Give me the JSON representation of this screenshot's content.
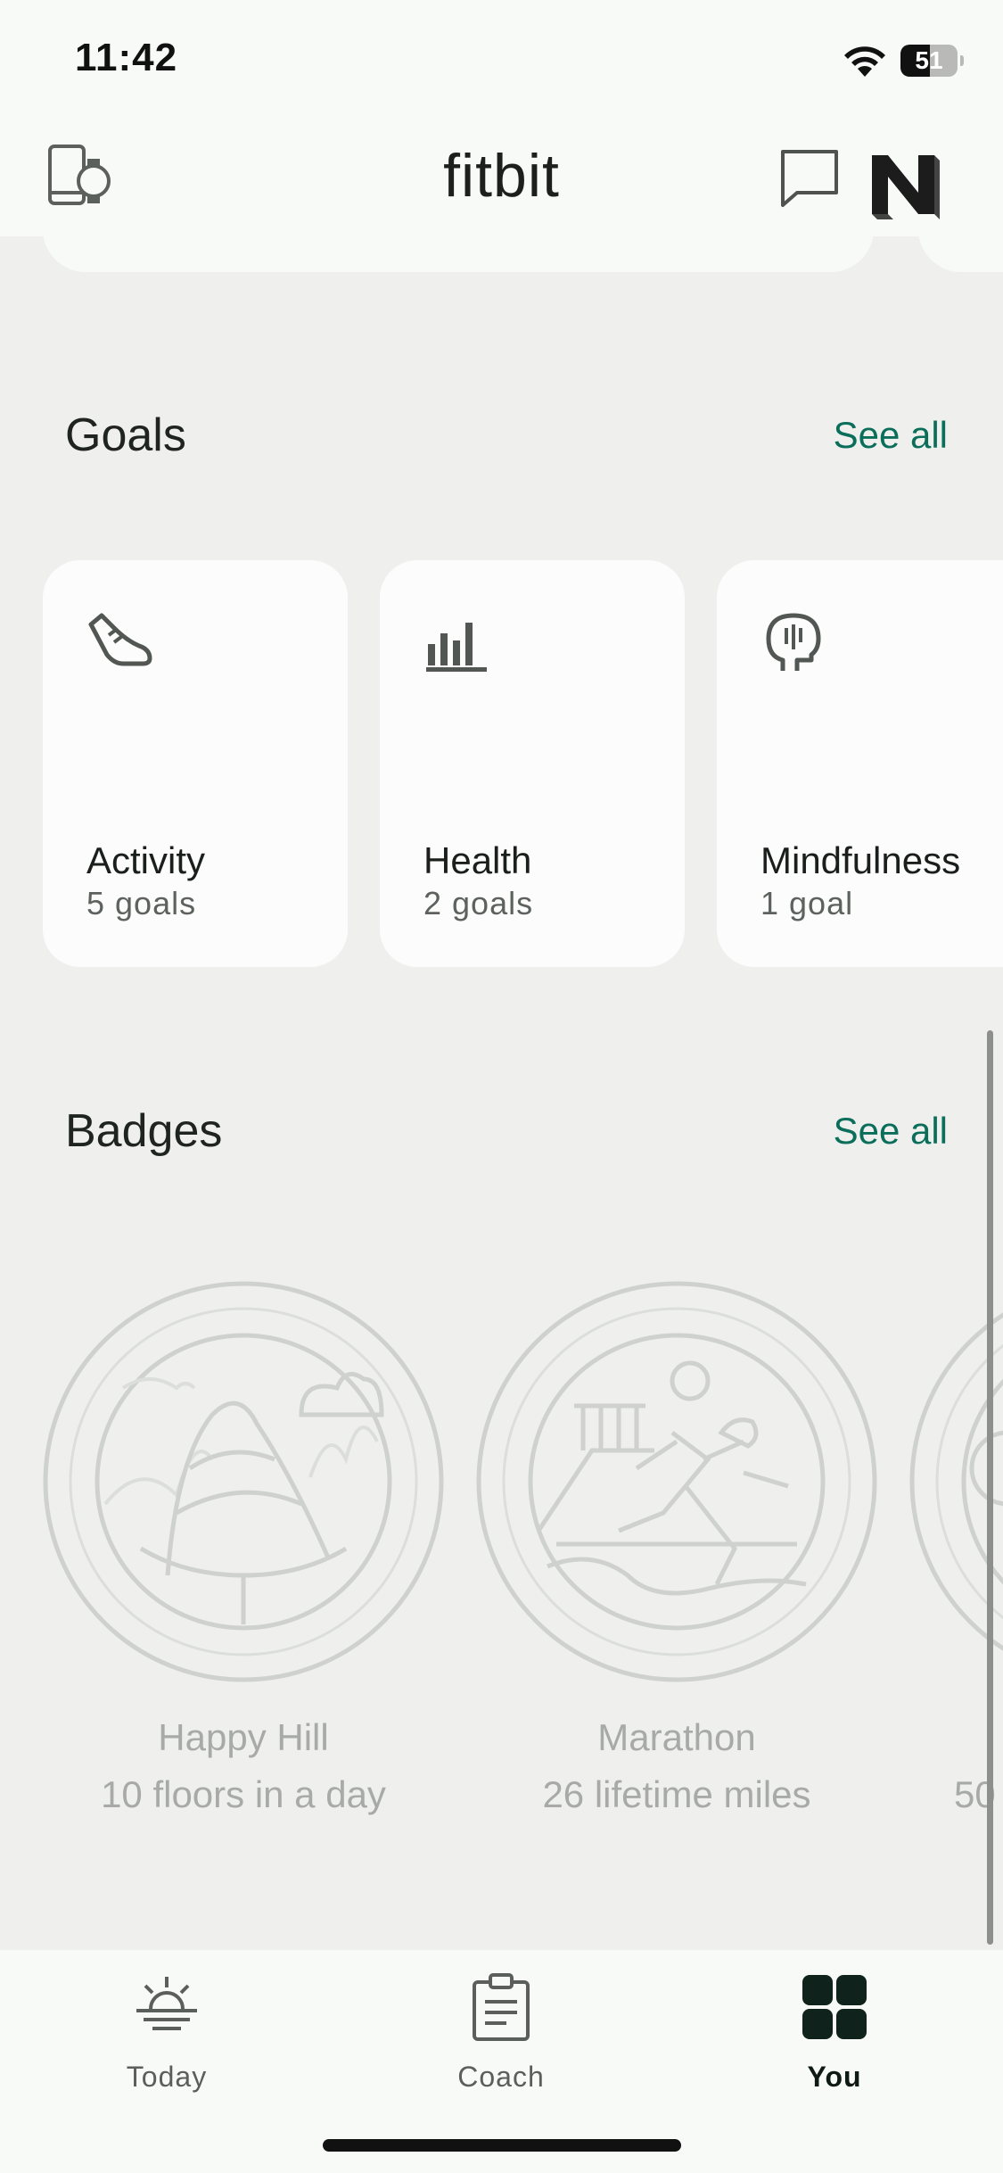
{
  "status_bar": {
    "time": "11:42",
    "battery": "51",
    "battery_level": 0.51
  },
  "header": {
    "app_title": "fitbit",
    "avatar_letter": "N"
  },
  "goals": {
    "title": "Goals",
    "see_all": "See all",
    "cards": [
      {
        "name": "Activity",
        "count": "5 goals",
        "icon": "shoe-icon"
      },
      {
        "name": "Health",
        "count": "2 goals",
        "icon": "bar-chart-icon"
      },
      {
        "name": "Mindfulness",
        "count": "1 goal",
        "icon": "head-mind-icon"
      }
    ]
  },
  "badges": {
    "title": "Badges",
    "see_all": "See all",
    "items": [
      {
        "name": "Happy Hill",
        "desc": "10 floors in a day",
        "icon": "hill-badge-icon"
      },
      {
        "name": "Marathon",
        "desc": "26 lifetime miles",
        "icon": "runner-badge-icon"
      },
      {
        "name": "",
        "desc": "50",
        "icon": "partial-badge-icon"
      }
    ]
  },
  "bottom_nav": {
    "items": [
      {
        "label": "Today",
        "icon": "sunrise-icon",
        "active": false
      },
      {
        "label": "Coach",
        "icon": "clipboard-icon",
        "active": false
      },
      {
        "label": "You",
        "icon": "grid-icon",
        "active": true
      }
    ]
  },
  "colors": {
    "accent": "#0b6e5a",
    "background": "#eff0ee",
    "card": "#fbfcfb",
    "badge_line": "#cfd1cf"
  }
}
